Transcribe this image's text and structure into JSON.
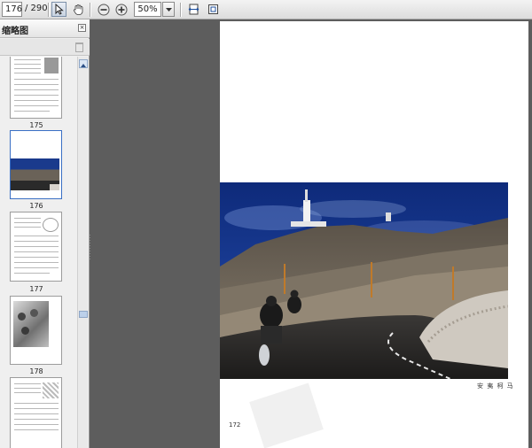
{
  "toolbar": {
    "page_current": "176",
    "page_total": "/ 290",
    "zoom_value": "50%",
    "tools": [
      {
        "name": "select-tool",
        "icon": "arrow-cursor-icon"
      },
      {
        "name": "hand-tool",
        "icon": "hand-icon"
      },
      {
        "name": "zoom-out",
        "icon": "minus-circle-icon"
      },
      {
        "name": "zoom-in",
        "icon": "plus-circle-icon"
      },
      {
        "name": "fit-width",
        "icon": "fit-width-icon"
      },
      {
        "name": "fit-page",
        "icon": "fit-page-icon"
      }
    ]
  },
  "panel": {
    "title": "缩略图",
    "thumbnails": [
      {
        "label": "175"
      },
      {
        "label": "176",
        "selected": true
      },
      {
        "label": "177"
      },
      {
        "label": "178"
      },
      {
        "label": ""
      }
    ]
  },
  "document": {
    "caption": "安 夷 柯 马",
    "page_number": "172"
  },
  "colors": {
    "workspace": "#5d5d5d",
    "panel": "#efefef",
    "sky": "#1a3a8c",
    "selection": "#3a6fc4"
  }
}
